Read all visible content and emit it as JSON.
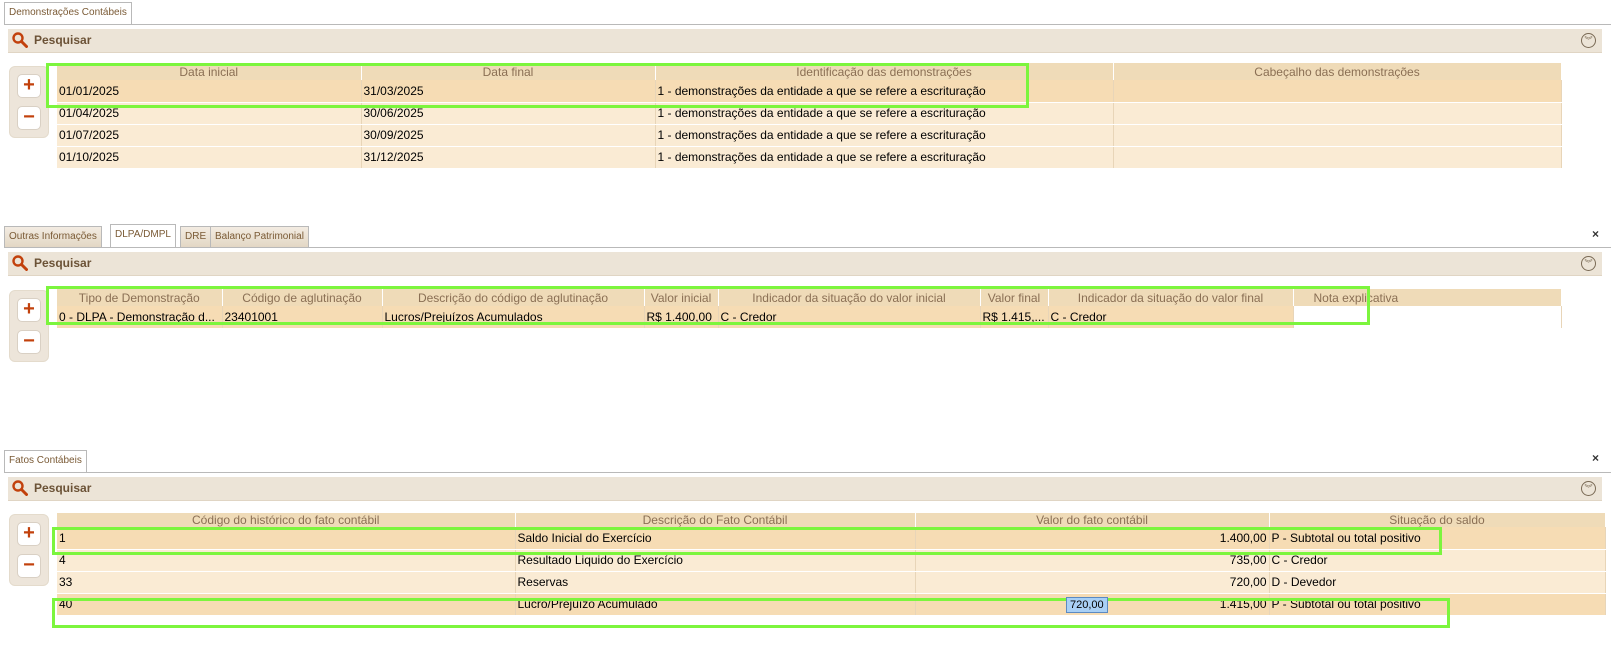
{
  "top_tab": "Demonstrações Contábeis",
  "search_label": "Pesquisar",
  "demonstracoes": {
    "columns": [
      "Data inicial",
      "Data final",
      "Identificação das demonstrações",
      "Cabeçalho das demonstrações"
    ],
    "rows": [
      [
        "01/01/2025",
        "31/03/2025",
        "1 - demonstrações da entidade a que se refere a escrituração",
        ""
      ],
      [
        "01/04/2025",
        "30/06/2025",
        "1 - demonstrações da entidade a que se refere a escrituração",
        ""
      ],
      [
        "01/07/2025",
        "30/09/2025",
        "1 - demonstrações da entidade a que se refere a escrituração",
        ""
      ],
      [
        "01/10/2025",
        "31/12/2025",
        "1 - demonstrações da entidade a que se refere a escrituração",
        ""
      ]
    ]
  },
  "mid_tabs": [
    "Outras Informações",
    "DLPA/DMPL",
    "DRE",
    "Balanço Patrimonial"
  ],
  "dlpa": {
    "columns": [
      "Tipo de Demonstração",
      "Código de aglutinação",
      "Descrição do código de aglutinação",
      "Valor inicial",
      "Indicador da situação do valor inicial",
      "Valor final",
      "Indicador da situação do valor final",
      "Nota explicativa"
    ],
    "rows": [
      [
        "0 - DLPA - Demonstração d...",
        "23401001",
        "Lucros/Prejuízos Acumulados",
        "R$ 1.400,00",
        "C - Credor",
        "R$ 1.415,...",
        "C - Credor",
        ""
      ]
    ]
  },
  "fatos_tab": "Fatos Contábeis",
  "fatos": {
    "columns": [
      "Código do histórico do fato contábil",
      "Descrição do Fato Contábil",
      "Valor do fato contábil",
      "Situação do saldo"
    ],
    "rows": [
      [
        "1",
        "Saldo Inicial do Exercício",
        "1.400,00",
        "P - Subtotal ou total positivo"
      ],
      [
        "4",
        "Resultado Liquido do Exercício",
        "735,00",
        "C - Credor"
      ],
      [
        "33",
        "Reservas",
        "720,00",
        "D - Devedor"
      ],
      [
        "40",
        "Lucro/Prejuízo Acumulado",
        "1.415,00",
        "P - Subtotal ou total positivo"
      ]
    ]
  },
  "tooltip": "720,00",
  "close_symbol": "×",
  "icons": {
    "search": "search-icon",
    "expand": "double-chevron-down-icon",
    "add": "plus-icon",
    "remove": "minus-icon"
  },
  "colors": {
    "header": "#efdbb8",
    "row": "#faebd4",
    "selected_row": "#f6dcb4",
    "highlight": "#7cf53d",
    "accent": "#c2410c"
  }
}
